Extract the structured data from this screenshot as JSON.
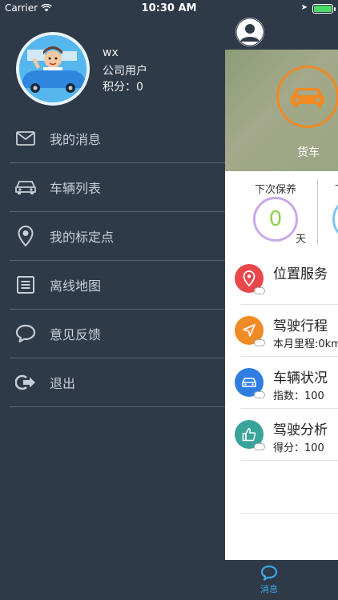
{
  "status_bar": {
    "carrier": "Carrier",
    "time": "10:30 AM"
  },
  "drawer": {
    "user": {
      "name": "wx",
      "type": "公司用户",
      "points": "积分：0"
    },
    "menu": [
      {
        "label": "我的消息",
        "icon": "mail-icon"
      },
      {
        "label": "车辆列表",
        "icon": "car-icon"
      },
      {
        "label": "我的标定点",
        "icon": "location-pin-icon"
      },
      {
        "label": "离线地图",
        "icon": "list-doc-icon"
      },
      {
        "label": "意见反馈",
        "icon": "chat-bubble-icon"
      },
      {
        "label": "退出",
        "icon": "logout-icon"
      }
    ]
  },
  "main": {
    "hero": {
      "vehicle_label": "货车"
    },
    "stats": {
      "next_maintenance_label": "下次保养",
      "days_value": "0",
      "days_unit": "天"
    },
    "services": [
      {
        "title": "位置服务",
        "subtitle": "",
        "color": "#e8474b",
        "icon": "location-pin-icon"
      },
      {
        "title": "驾驶行程",
        "subtitle": "本月里程:0km",
        "color": "#f08a24",
        "icon": "navigation-icon"
      },
      {
        "title": "车辆状况",
        "subtitle": "指数：100",
        "color": "#2f7de0",
        "icon": "car-icon"
      },
      {
        "title": "驾驶分析",
        "subtitle": "得分：100",
        "color": "#3aa39a",
        "icon": "thumbs-up-icon"
      }
    ],
    "tabbar": {
      "messages_label": "消息"
    }
  }
}
